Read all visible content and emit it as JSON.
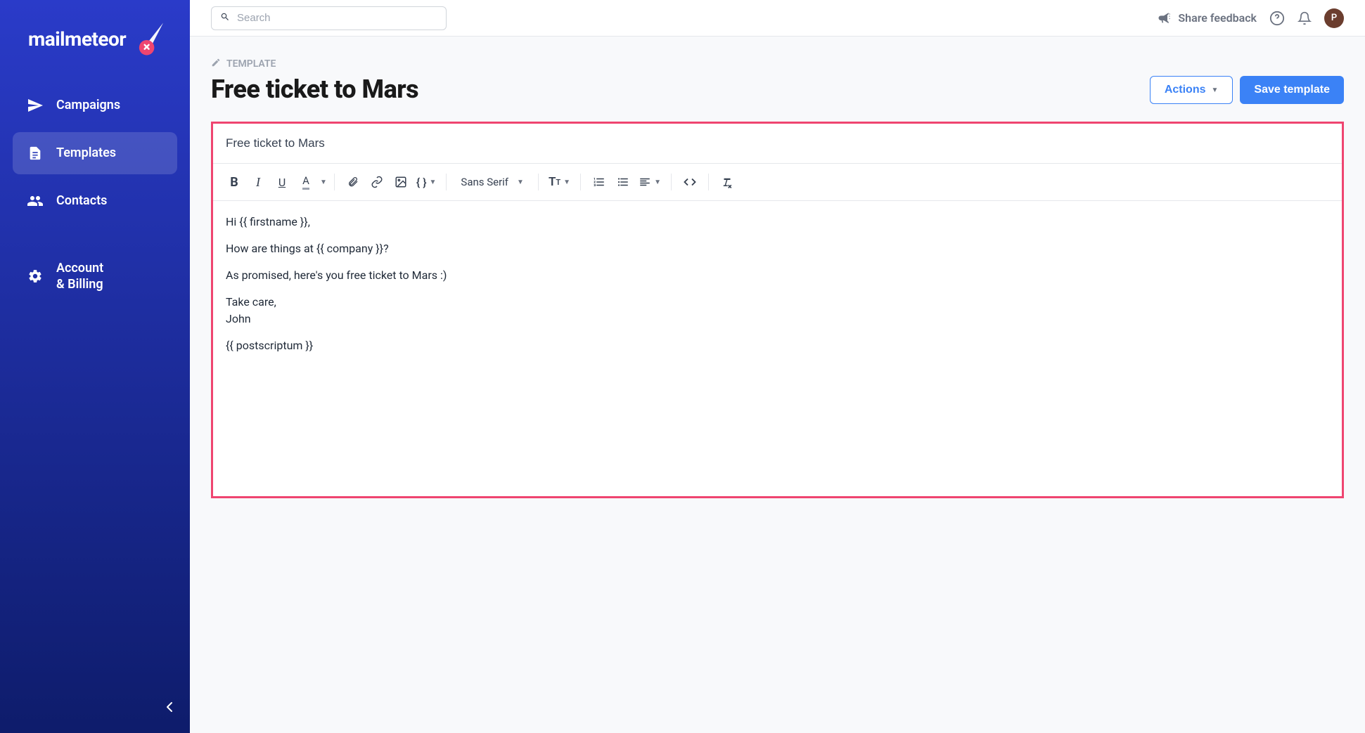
{
  "brand": {
    "name": "mailmeteor"
  },
  "sidebar": {
    "items": [
      {
        "label": "Campaigns",
        "icon": "send"
      },
      {
        "label": "Templates",
        "icon": "file"
      },
      {
        "label": "Contacts",
        "icon": "people"
      },
      {
        "label": "Account\n& Billing",
        "icon": "gear"
      }
    ]
  },
  "topbar": {
    "search_placeholder": "Search",
    "feedback_label": "Share feedback",
    "avatar_initial": "P"
  },
  "page": {
    "breadcrumb": "TEMPLATE",
    "title": "Free ticket to Mars",
    "actions_label": "Actions",
    "save_label": "Save template"
  },
  "editor": {
    "subject": "Free ticket to Mars",
    "font_label": "Sans Serif",
    "body": {
      "line1": "Hi {{ firstname }},",
      "line2": "How are things at {{ company }}?",
      "line3": "As promised, here's you free ticket to Mars :)",
      "line4a": "Take care,",
      "line4b": "John",
      "line5": "{{ postscriptum }}"
    }
  }
}
